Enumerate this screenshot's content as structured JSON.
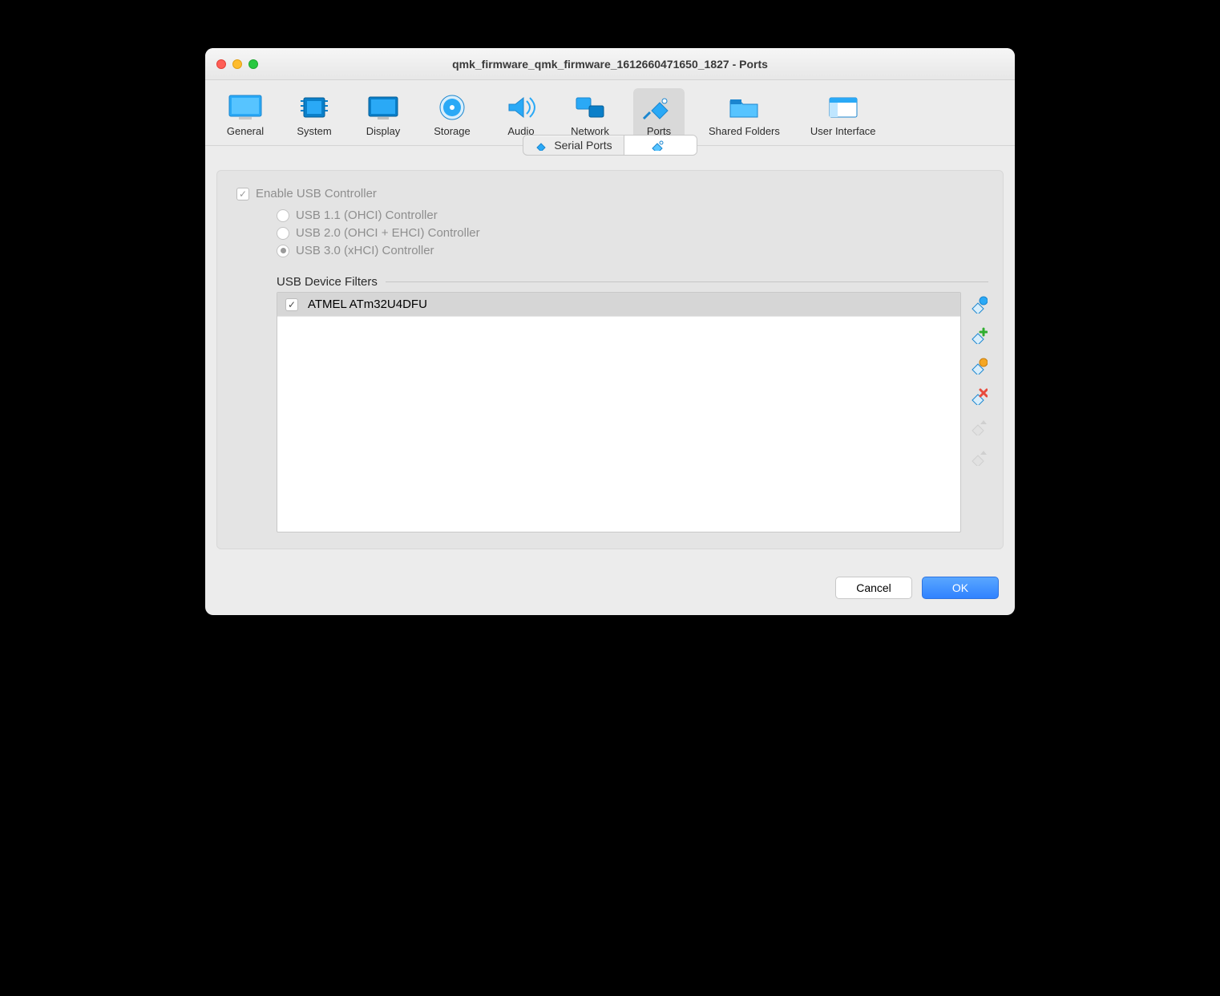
{
  "window": {
    "title": "qmk_firmware_qmk_firmware_1612660471650_1827 - Ports"
  },
  "toolbar": {
    "items": [
      {
        "label": "General"
      },
      {
        "label": "System"
      },
      {
        "label": "Display"
      },
      {
        "label": "Storage"
      },
      {
        "label": "Audio"
      },
      {
        "label": "Network"
      },
      {
        "label": "Ports"
      },
      {
        "label": "Shared Folders"
      },
      {
        "label": "User Interface"
      }
    ]
  },
  "segments": {
    "serial": "Serial Ports",
    "usb": ""
  },
  "usb": {
    "enable_label": "Enable USB Controller",
    "enable_checked": true,
    "radios": [
      {
        "label": "USB 1.1 (OHCI) Controller",
        "selected": false
      },
      {
        "label": "USB 2.0 (OHCI + EHCI) Controller",
        "selected": false
      },
      {
        "label": "USB 3.0 (xHCI) Controller",
        "selected": true
      }
    ],
    "filters_title": "USB Device Filters",
    "filters": [
      {
        "label": "ATMEL ATm32U4DFU",
        "checked": true
      }
    ]
  },
  "footer": {
    "cancel": "Cancel",
    "ok": "OK"
  }
}
